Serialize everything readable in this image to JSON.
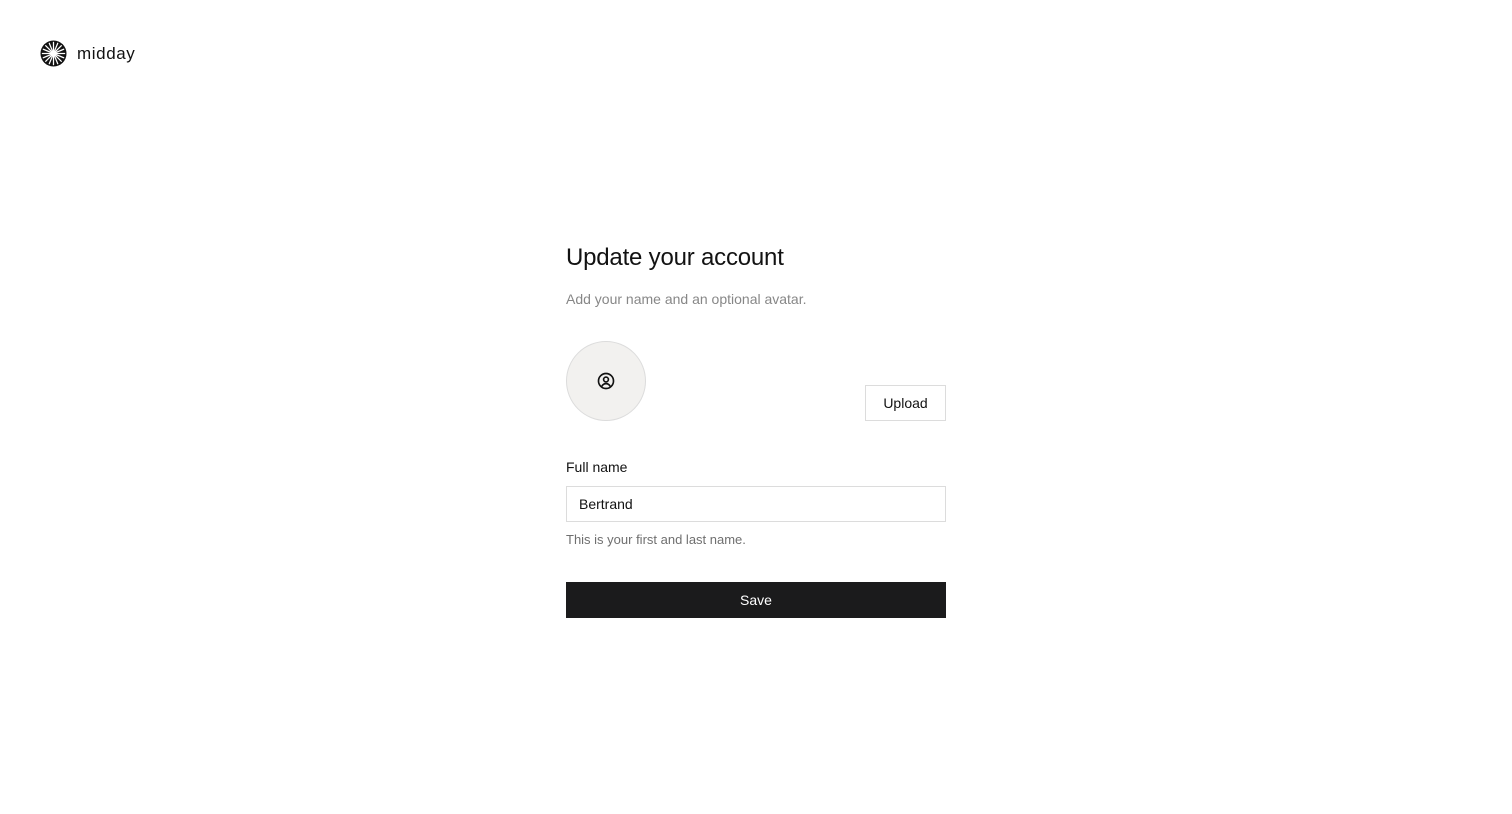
{
  "brand": {
    "name": "midday",
    "logo_icon": "midday-logo-icon"
  },
  "form": {
    "title": "Update your account",
    "subtitle": "Add your name and an optional avatar.",
    "avatar": {
      "icon": "user-circle-icon"
    },
    "upload_label": "Upload",
    "full_name": {
      "label": "Full name",
      "value": "Bertrand",
      "placeholder": "",
      "help": "This is your first and last name."
    },
    "save_label": "Save"
  },
  "colors": {
    "primary_button": "#1b1b1c",
    "muted_text": "#878787",
    "border": "#dcdcdc",
    "avatar_bg": "#f2f1ef"
  }
}
